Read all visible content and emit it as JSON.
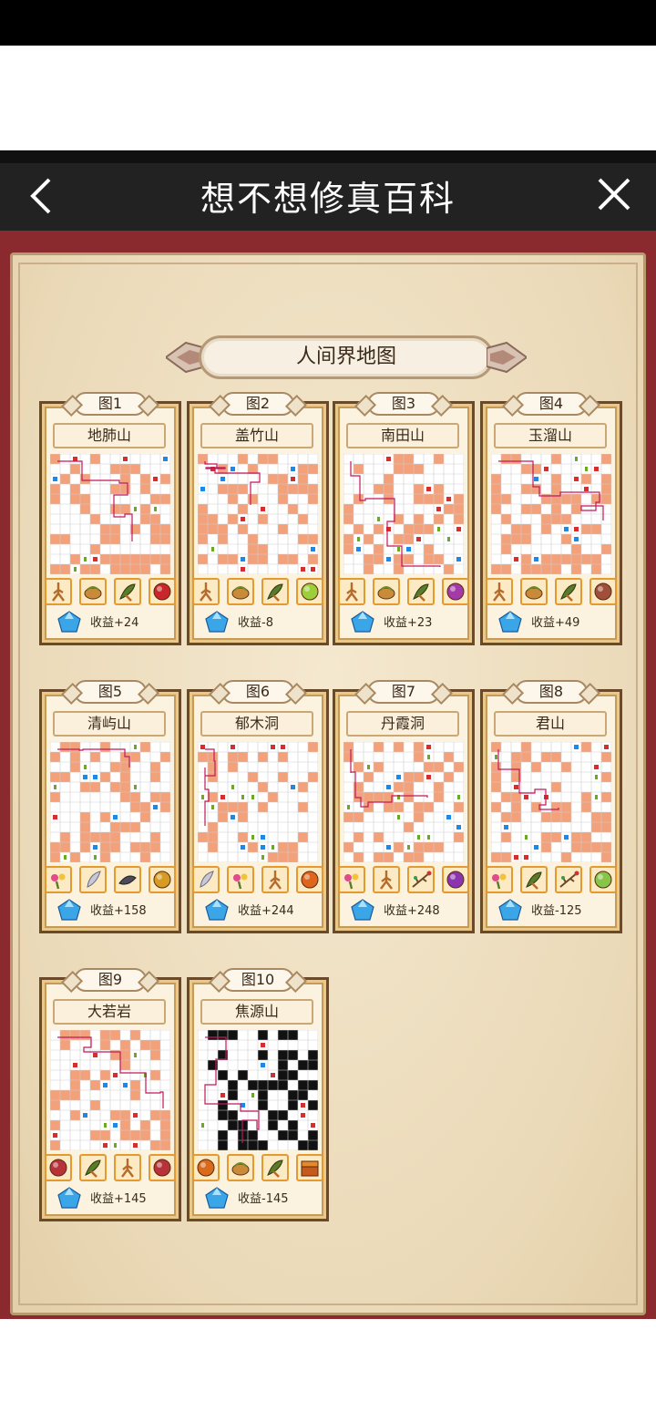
{
  "header": {
    "title": "想不想修真百科"
  },
  "section": {
    "title": "人间界地图"
  },
  "maps": [
    {
      "tag": "图1",
      "name": "地肺山",
      "income": "收益+24",
      "items": [
        "ginseng-icon",
        "fruit-icon",
        "herb-icon",
        "red-orb-icon"
      ],
      "orb": "#c8262a"
    },
    {
      "tag": "图2",
      "name": "盖竹山",
      "income": "收益-8",
      "items": [
        "ginseng-icon",
        "fruit-icon",
        "herb-icon",
        "green-orb-icon"
      ],
      "orb": "#9ccf3a"
    },
    {
      "tag": "图3",
      "name": "南田山",
      "income": "收益+23",
      "items": [
        "ginseng-icon",
        "fruit-icon",
        "herb-icon",
        "purple-orb-icon"
      ],
      "orb": "#a43aa8"
    },
    {
      "tag": "图4",
      "name": "玉溜山",
      "income": "收益+49",
      "items": [
        "ginseng-icon",
        "fruit-icon",
        "herb-icon",
        "brown-orb-icon"
      ],
      "orb": "#a0503a"
    },
    {
      "tag": "图5",
      "name": "清屿山",
      "income": "收益+158",
      "items": [
        "flower-icon",
        "feather-icon",
        "leaf-icon",
        "gold-orb-icon"
      ],
      "orb": "#d79a22"
    },
    {
      "tag": "图6",
      "name": "郁木洞",
      "income": "收益+244",
      "items": [
        "feather-icon",
        "flower-icon",
        "ginseng-icon",
        "orange-orb-icon"
      ],
      "orb": "#e0661e"
    },
    {
      "tag": "图7",
      "name": "丹霞洞",
      "income": "收益+248",
      "items": [
        "flower-icon",
        "ginseng-icon",
        "branch-icon",
        "purple-orb-icon"
      ],
      "orb": "#8a34b0"
    },
    {
      "tag": "图8",
      "name": "君山",
      "income": "收益-125",
      "items": [
        "flower-icon",
        "herb-icon",
        "branch-icon",
        "green-orb-icon"
      ],
      "orb": "#86c54a"
    },
    {
      "tag": "图9",
      "name": "大若岩",
      "income": "收益+145",
      "items": [
        "gold-orb-icon",
        "herb-icon",
        "ginseng-icon",
        "red-orb-icon"
      ],
      "orb": "#b8323a"
    },
    {
      "tag": "图10",
      "name": "焦源山",
      "income": "收益-145",
      "items": [
        "gold-orb-icon",
        "fruit-icon",
        "herb-icon",
        "chest-icon"
      ],
      "orb": "#d86a1a"
    }
  ],
  "colors": {
    "frame": "#8a2a2e",
    "parchment": "#eedfc2",
    "path": "#f2a17a",
    "route": "#c2185b"
  }
}
